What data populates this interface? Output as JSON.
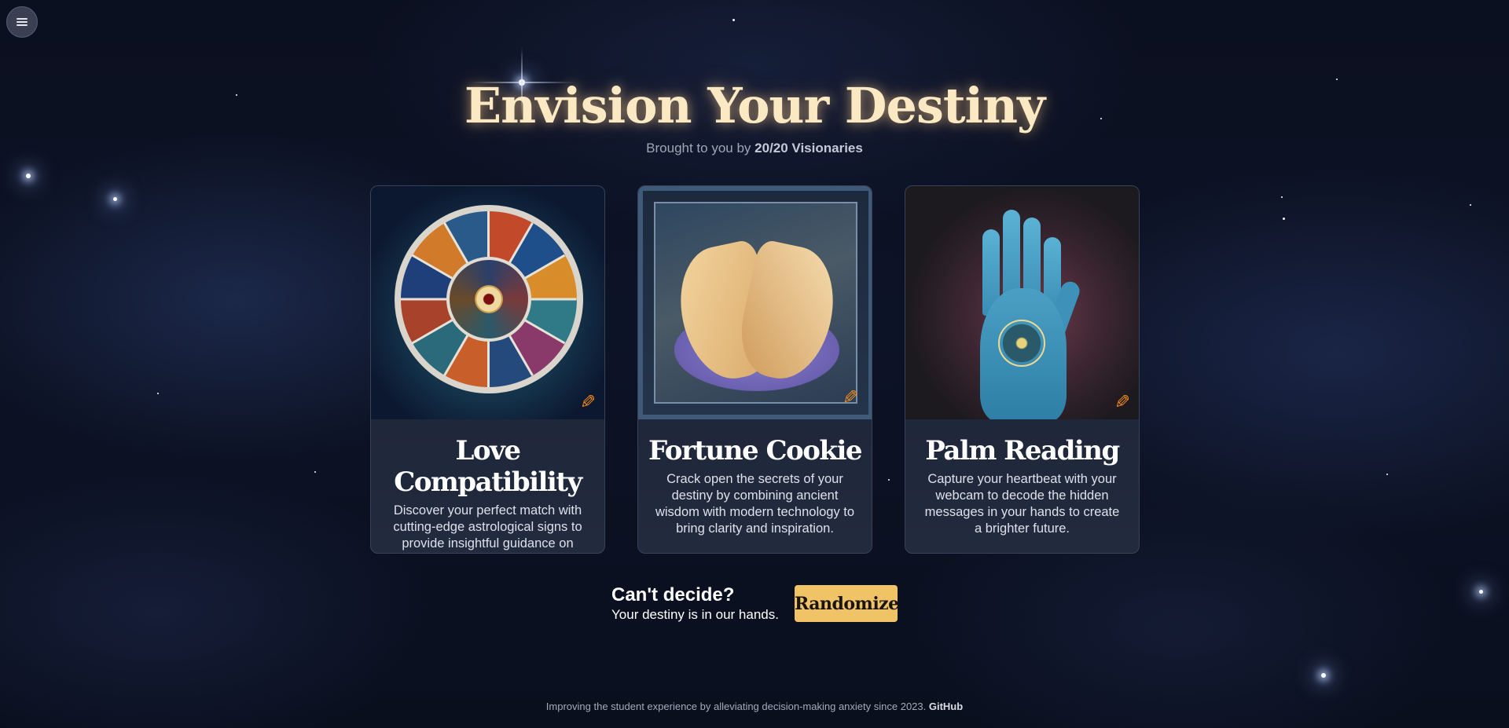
{
  "menu": {
    "icon": "hamburger-icon"
  },
  "hero": {
    "title": "Envision Your Destiny",
    "subtitle_prefix": "Brought to you by ",
    "subtitle_brand": "20/20 Visionaries",
    "title_color": "#fbe9c4"
  },
  "cards": [
    {
      "title": "Love Compatibility",
      "description": "Discover your perfect match with cutting-edge astrological signs to provide insightful guidance on finding lasting love.",
      "image": "zodiac-wheel-image",
      "edit_icon": "pencil-icon"
    },
    {
      "title": "Fortune Cookie",
      "description": "Crack open the secrets of your destiny by combining ancient wisdom with modern technology to bring clarity and inspiration.",
      "image": "fortune-cookie-image",
      "edit_icon": "pencil-icon"
    },
    {
      "title": "Palm Reading",
      "description": "Capture your heartbeat with your webcam to decode the hidden messages in your hands to create a brighter future.",
      "image": "palm-image",
      "edit_icon": "pencil-icon"
    }
  ],
  "cta": {
    "heading": "Can't decide?",
    "text": "Your destiny is in our hands.",
    "button_label": "Randomize",
    "button_color": "#f0c466"
  },
  "footer": {
    "text": "Improving the student experience by alleviating decision-making anxiety since 2023. ",
    "link": "GitHub"
  }
}
